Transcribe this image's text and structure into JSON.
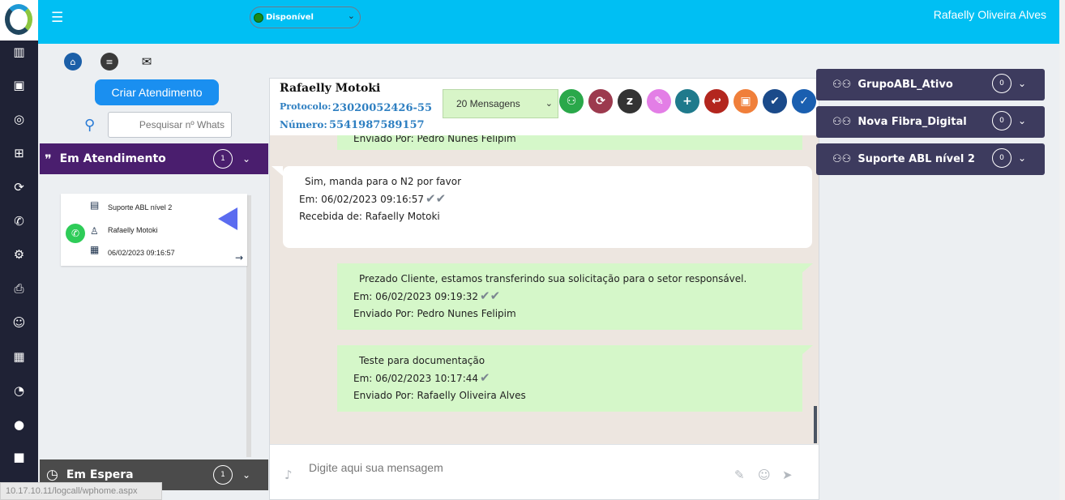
{
  "app": {
    "user_name": "Rafaelly Oliveira Alves",
    "status": {
      "label": "Disponível",
      "color": "#1a8a1a"
    },
    "colors": {
      "topbar": "#00bff3",
      "sidebar": "#1f2235",
      "group_active": "#4a1e6e",
      "group_wait": "#4b4b4b",
      "right_group": "#3d3b5e"
    }
  },
  "sidebar": {
    "icons": [
      "chart-icon",
      "briefcase-icon",
      "whatsapp-icon",
      "plus-square-icon",
      "sync-icon",
      "phone-icon",
      "gear-icon",
      "printer-icon",
      "smiley-icon",
      "calendar-icon",
      "dashboard-icon",
      "chat-bubble-icon",
      "video-icon"
    ]
  },
  "left": {
    "create_button": "Criar Atendimento",
    "search_placeholder": "Pesquisar nº Whats",
    "active_group": {
      "title": "Em Atendimento",
      "count": "1"
    },
    "waiting_group": {
      "title": "Em Espera",
      "count": "1"
    },
    "card": {
      "queue": "Suporte ABL nível 2",
      "contact": "Rafaelly Motoki",
      "datetime": "06/02/2023 09:16:57"
    },
    "url_tooltip": "10.17.10.11/logcall/wphome.aspx"
  },
  "chat": {
    "contact_name": "Rafaelly Motoki",
    "protocol_label": "Protocolo:",
    "protocol_value": "23020052426-55",
    "number_label": "Número:",
    "number_value": "5541987589157",
    "message_count": "20 Mensagens",
    "partial_top": "Enviado Por: Pedro Nunes Felipim",
    "messages": [
      {
        "dir": "in",
        "text": "Sim, manda para o N2 por favor",
        "time": "Em: 06/02/2023 09:16:57",
        "meta": "Recebida de: Rafaelly Motoki"
      },
      {
        "dir": "out",
        "text": "Prezado Cliente, estamos transferindo sua solicitação para o setor responsável.",
        "time": "Em: 06/02/2023 09:19:32",
        "meta": "Enviado Por: Pedro Nunes Felipim"
      },
      {
        "dir": "out",
        "text": "Teste para documentação",
        "time": "Em: 06/02/2023 10:17:44",
        "meta": "Enviado Por: Rafaelly Oliveira Alves"
      }
    ],
    "input_placeholder": "Digite aqui sua mensagem"
  },
  "right": {
    "groups": [
      {
        "name": "GrupoABL_Ativo",
        "count": "0"
      },
      {
        "name": "Nova Fibra_Digital",
        "count": "0"
      },
      {
        "name": "Suporte ABL nível 2",
        "count": "0"
      }
    ]
  }
}
